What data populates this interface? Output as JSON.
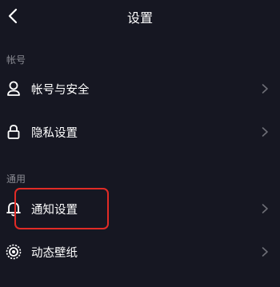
{
  "header": {
    "title": "设置",
    "back_icon": "chevron-left-icon"
  },
  "sections": {
    "account": "帐号",
    "general": "通用"
  },
  "items": [
    {
      "label": "帐号与安全",
      "icon": "person-icon"
    },
    {
      "label": "隐私设置",
      "icon": "lock-icon"
    },
    {
      "label": "通知设置",
      "icon": "bell-icon"
    },
    {
      "label": "动态壁纸",
      "icon": "wallpaper-icon"
    }
  ],
  "colors": {
    "background": "#161722",
    "text": "#ffffff",
    "section_text": "#8a8b93",
    "chevron": "#6d6e76",
    "highlight": "#e12b26"
  }
}
